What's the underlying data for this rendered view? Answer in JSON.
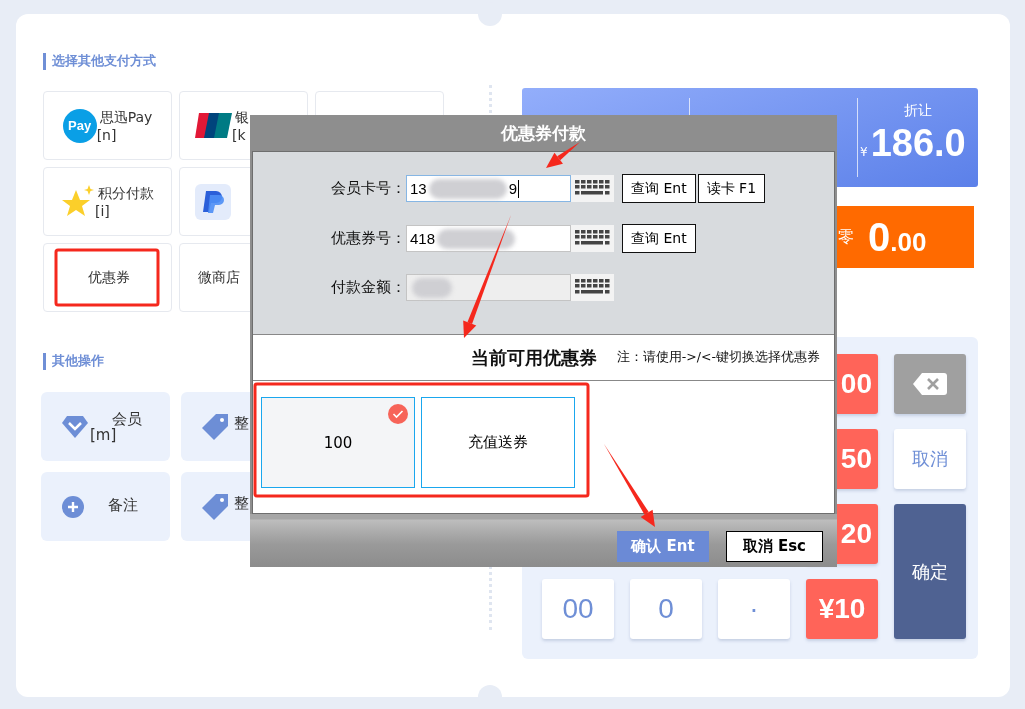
{
  "payment_section": {
    "title": "选择其他支付方式",
    "rows": [
      [
        {
          "kind": "pay",
          "logo_text": "Pay",
          "label": "思迅Pay",
          "shortcut": "[n]"
        },
        {
          "kind": "unionpay",
          "label": "银",
          "shortcut": "[k"
        },
        {
          "kind": "blank"
        }
      ],
      [
        {
          "kind": "star",
          "label": "积分付款",
          "shortcut": "[i]"
        },
        {
          "kind": "paypal"
        }
      ],
      [
        {
          "kind": "text",
          "label": "优惠券"
        },
        {
          "kind": "text",
          "label": "微商店"
        }
      ]
    ]
  },
  "operations_section": {
    "title": "其他操作",
    "rows": [
      [
        {
          "kind": "diamond",
          "label": "会员",
          "shortcut": "[m]"
        },
        {
          "kind": "tag",
          "label": "整"
        }
      ],
      [
        {
          "kind": "plus",
          "label": "备注"
        },
        {
          "kind": "tag",
          "label": "整"
        }
      ]
    ]
  },
  "summary": {
    "discount": {
      "label": "折让",
      "currency": "¥",
      "amount": "186.0"
    }
  },
  "change": {
    "label": "零",
    "integer": "0",
    "decimal": ".00"
  },
  "keypad": [
    {
      "kind": "quick",
      "label": "00"
    },
    {
      "kind": "backspace"
    },
    {
      "kind": "quick",
      "label": "50"
    },
    {
      "kind": "cancel",
      "label": "取消"
    },
    {
      "kind": "quick",
      "label": "20"
    },
    {
      "kind": "confirm",
      "label": "确定"
    },
    {
      "kind": "digit",
      "label": "00"
    },
    {
      "kind": "digit",
      "label": "0"
    },
    {
      "kind": "digit",
      "label": "·"
    },
    {
      "kind": "quick",
      "label": "¥10"
    }
  ],
  "dialog": {
    "title": "优惠券付款",
    "fields": [
      {
        "label": "会员卡号：",
        "value_start": "13",
        "value_end": "9",
        "redacted": true,
        "focused": true,
        "disabled": false,
        "buttons": [
          "查询 Ent",
          "读卡 F1"
        ]
      },
      {
        "label": "优惠券号：",
        "value_start": "418",
        "redacted": true,
        "focused": false,
        "disabled": false,
        "buttons": [
          "查询 Ent"
        ]
      },
      {
        "label": "付款金额：",
        "redacted": true,
        "focused": false,
        "disabled": true
      }
    ],
    "coupons": {
      "title": "当前可用优惠券",
      "note": "注：请使用->/<-键切换选择优惠券",
      "items": [
        {
          "label": "100",
          "selected": true
        },
        {
          "label": "充值送券",
          "selected": false
        }
      ]
    },
    "buttons": [
      {
        "kind": "primary",
        "label": "确认 Ent"
      },
      {
        "kind": "secondary",
        "label": "取消 Esc"
      }
    ]
  }
}
